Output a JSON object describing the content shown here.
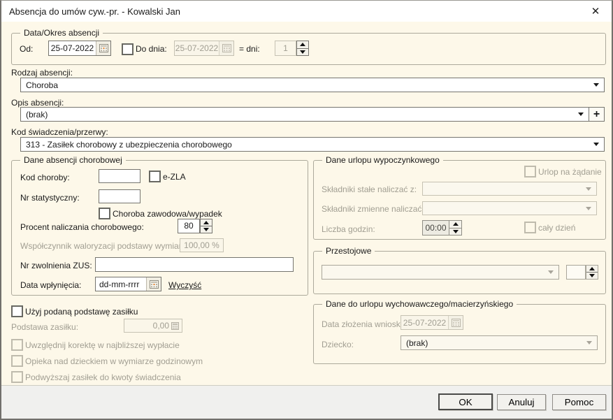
{
  "window": {
    "title": "Absencja do umów cyw.-pr. - Kowalski Jan",
    "close": "✕"
  },
  "period": {
    "title": "Data/Okres absencji",
    "od_label": "Od:",
    "od_value": "25-07-2022",
    "do_label": "Do dnia:",
    "do_value": "25-07-2022",
    "dni_label": "= dni:",
    "dni_value": "1"
  },
  "rodzaj": {
    "label": "Rodzaj absencji:",
    "value": "Choroba"
  },
  "opis": {
    "label": "Opis absencji:",
    "value": "(brak)",
    "add": "+"
  },
  "kod": {
    "label": "Kod świadczenia/przerwy:",
    "value": "313 - Zasiłek chorobowy z ubezpieczenia chorobowego"
  },
  "chorobowa": {
    "title": "Dane absencji chorobowej",
    "kod_choroby_label": "Kod choroby:",
    "ezla_label": "e-ZLA",
    "nr_stat_label": "Nr statystyczny:",
    "zawodowa_label": "Choroba zawodowa/wypadek",
    "procent_label": "Procent naliczania chorobowego:",
    "procent_value": "80",
    "walor_label": "Współczynnik waloryzacji podstawy wymiaru:",
    "walor_value": "100,00 %",
    "zus_label": "Nr zwolnienia ZUS:",
    "data_wpl_label": "Data wpłynięcia:",
    "data_wpl_mask": "dd-mm-rrrr",
    "wyczysc_link": "Wyczyść"
  },
  "zasilek": {
    "uzyj_label": "Użyj podaną podstawę zasiłku",
    "podstawa_label": "Podstawa zasiłku:",
    "podstawa_value": "0,00",
    "korekta_label": "Uwzględnij korektę w najbliższej wypłacie",
    "opieka_label": "Opieka nad dzieckiem w wymiarze godzinowym",
    "podwyzszaj_label": "Podwyższaj zasiłek do kwoty świadczenia"
  },
  "urlop": {
    "title": "Dane urlopu wypoczynkowego",
    "zadanie_label": "Urlop na żądanie",
    "stale_label": "Składniki stałe naliczać z:",
    "zmienne_label": "Składniki zmienne naliczać z:",
    "godziny_label": "Liczba godzin:",
    "godziny_value": "00:00",
    "caly_dzien_label": "cały dzień"
  },
  "przestojowe": {
    "title": "Przestojowe"
  },
  "wychowawczy": {
    "title": "Dane do urlopu wychowawczego/macierzyńskiego",
    "data_label": "Data złożenia wniosku:",
    "data_value": "25-07-2022",
    "dziecko_label": "Dziecko:",
    "dziecko_value": "(brak)"
  },
  "buttons": {
    "ok": "OK",
    "anuluj": "Anuluj",
    "pomoc": "Pomoc"
  },
  "colors": {
    "dialog_bg": "#FDF8E9",
    "titlebar_bg": "#FFFFFF",
    "footer_bg": "#F0F0EE",
    "calendar_accent": "#E2802F",
    "disabled_text": "#A19E92",
    "group_border": "#ACA99B"
  }
}
